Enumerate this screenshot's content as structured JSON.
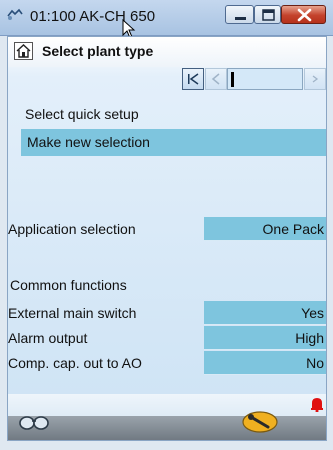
{
  "window": {
    "title": "01:100 AK-CH 650",
    "icons": [
      "app-icon",
      "minimize-icon",
      "maximize-icon",
      "close-icon",
      "mouse-cursor"
    ]
  },
  "screen": {
    "title": "Select plant type",
    "home_icon": "home-icon",
    "nav_icons": [
      "first-page-icon",
      "previous-page-icon",
      "next-page-icon"
    ]
  },
  "quick_setup": {
    "label": "Select quick setup",
    "value": "Make new selection"
  },
  "application": {
    "label": "Application selection",
    "value": "One Pack"
  },
  "common_functions": {
    "heading": "Common functions",
    "rows": [
      {
        "label": "External main switch",
        "value": "Yes"
      },
      {
        "label": "Alarm output",
        "value": "High"
      },
      {
        "label": "Comp. cap. out to AO",
        "value": "No"
      }
    ]
  },
  "toolbar": {
    "icons": [
      "glasses-icon",
      "wrench-icon",
      "alarm-bell-icon"
    ],
    "colors": {
      "alarm": "#e01010",
      "tool": "#f0b020",
      "value_bg": "#7ec5de"
    }
  }
}
